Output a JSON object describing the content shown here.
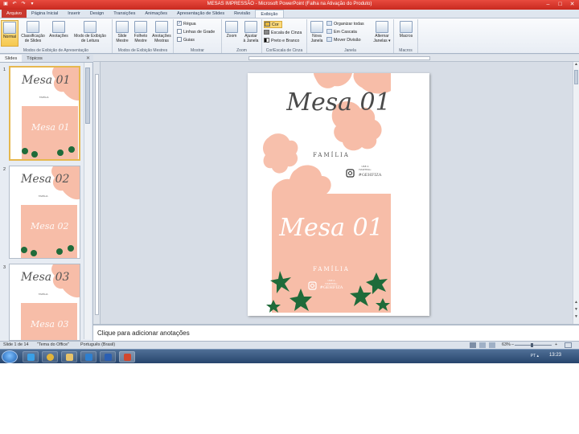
{
  "titlebar": {
    "title": "MESAS IMPRESSÃO  -  Microsoft PowerPoint (Falha na Ativação do Produto)",
    "qa_save": "▣",
    "qa_undo": "↶",
    "qa_redo": "↷",
    "qa_more": "▾",
    "min": "–",
    "max": "□",
    "close": "✕"
  },
  "tabs": [
    "Arquivo",
    "Página Inicial",
    "Inserir",
    "Design",
    "Transições",
    "Animações",
    "Apresentação de Slides",
    "Revisão",
    "Exibição"
  ],
  "ribbon": {
    "views": {
      "normal": "Normal",
      "sorter": [
        "Classificação",
        "de Slides"
      ],
      "notes": "Anotações",
      "reading": [
        "Modo de Exibição",
        "de Leitura"
      ],
      "label": "Modos de Exibição de Apresentação"
    },
    "master": {
      "slide": [
        "Slide",
        "Mestre"
      ],
      "handout": [
        "Folheto",
        "Mestre"
      ],
      "notes": [
        "Anotações",
        "Mestras"
      ],
      "label": "Modos de Exibição Mestres"
    },
    "show": {
      "ruler": "Régua",
      "grid": "Linhas de Grade",
      "guides": "Guias",
      "label": "Mostrar",
      "check": "✓"
    },
    "zoom": {
      "zoom": "Zoom",
      "fit": [
        "Ajustar",
        "à Janela"
      ],
      "label": "Zoom"
    },
    "color": {
      "color": "Cor",
      "grayscale": "Escala de Cinza",
      "bw": "Preto e Branco",
      "label": "Cor/Escala de Cinza"
    },
    "window": {
      "new": [
        "Nova",
        "Janela"
      ],
      "arrange": "Organizar todas",
      "cascade": "Em Cascata",
      "split": "Mover Divisão",
      "switch": [
        "Alternar",
        "Janelas ▾"
      ],
      "label": "Janela"
    },
    "macros": {
      "macros": "Macros",
      "label": "Macros"
    }
  },
  "panel": {
    "tab_slides": "Slides",
    "tab_topics": "Tópicos",
    "close": "✕",
    "slides": [
      {
        "num": "1",
        "title": "Mesa 01",
        "family": "FAMÍLIA"
      },
      {
        "num": "2",
        "title": "Mesa 02",
        "family": "FAMÍLIA"
      },
      {
        "num": "3",
        "title": "Mesa 03",
        "family": "FAMÍLIA"
      }
    ]
  },
  "slide": {
    "title": "Mesa 01",
    "family": "FAMÍLIA",
    "hashtag_small": [
      "USE A",
      "HASHTAG:"
    ],
    "hashtag": "#GEHFIZA",
    "title_bottom": "Mesa 01",
    "family_bottom": "FAMÍLIA",
    "colors": {
      "peach": "#f7bda8",
      "leaf": "#1f6b3a"
    }
  },
  "notes": {
    "placeholder": "Clique para adicionar anotações"
  },
  "status": {
    "slide": "Slide 1 de 14",
    "theme": "\"Tema do Office\"",
    "language": "Português (Brasil)",
    "zoom": "63%",
    "minus": "–",
    "plus": "+"
  },
  "taskbar": {
    "time": "13:23",
    "tray": "PT  ▴"
  }
}
